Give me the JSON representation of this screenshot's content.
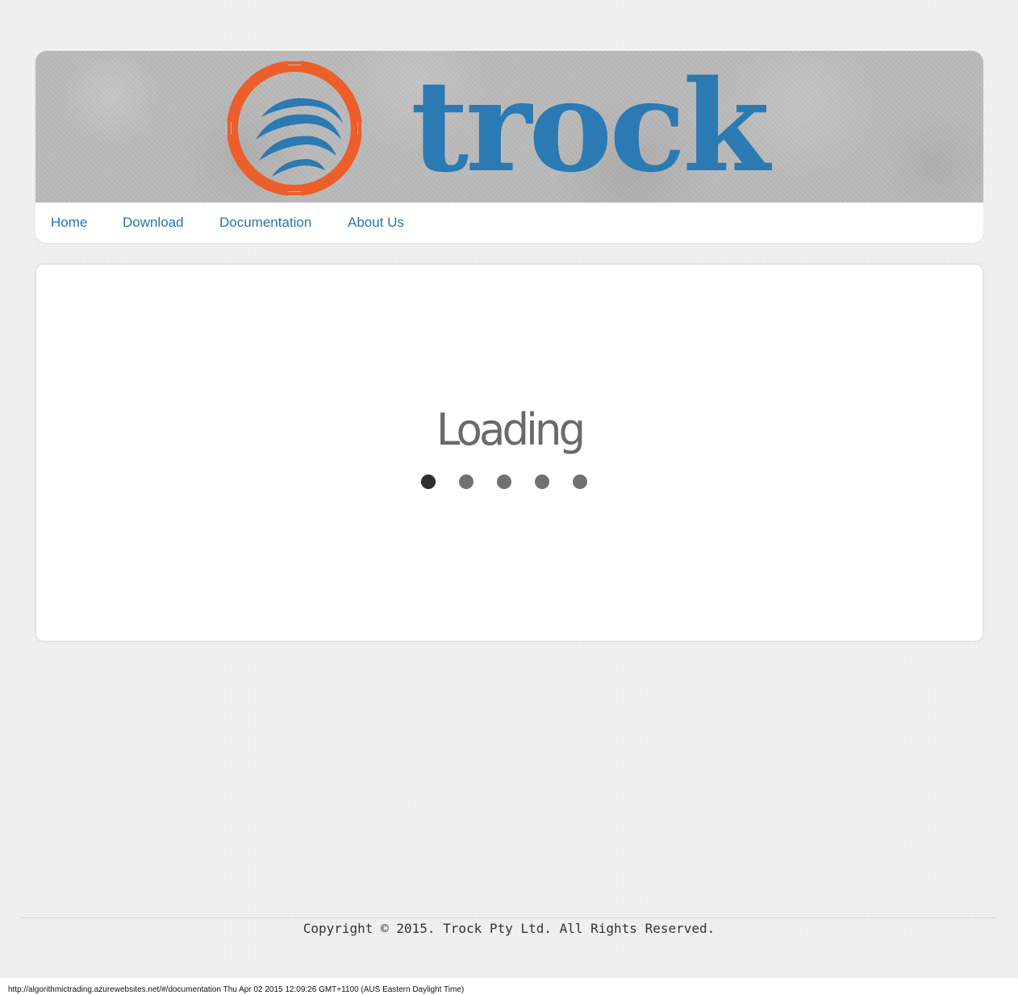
{
  "brand": {
    "name": "trock",
    "wordmark_color": "#2b7ab4",
    "mark_colors": {
      "ring": "#ec5f2b",
      "waves": "#2b7ab4"
    }
  },
  "nav": {
    "items": [
      {
        "label": "Home"
      },
      {
        "label": "Download"
      },
      {
        "label": "Documentation"
      },
      {
        "label": "About Us"
      }
    ],
    "link_color": "#2b72b0"
  },
  "main": {
    "loading_text": "Loading",
    "dots_total": 5,
    "active_dot": 1
  },
  "footer": {
    "copyright": "Copyright © 2015. Trock Pty Ltd. All Rights Reserved."
  },
  "status_line": "http://algorithmictrading.azurewebsites.net/#/documentation Thu Apr 02 2015 12:09:26 GMT+1100 (AUS Eastern Daylight Time)"
}
